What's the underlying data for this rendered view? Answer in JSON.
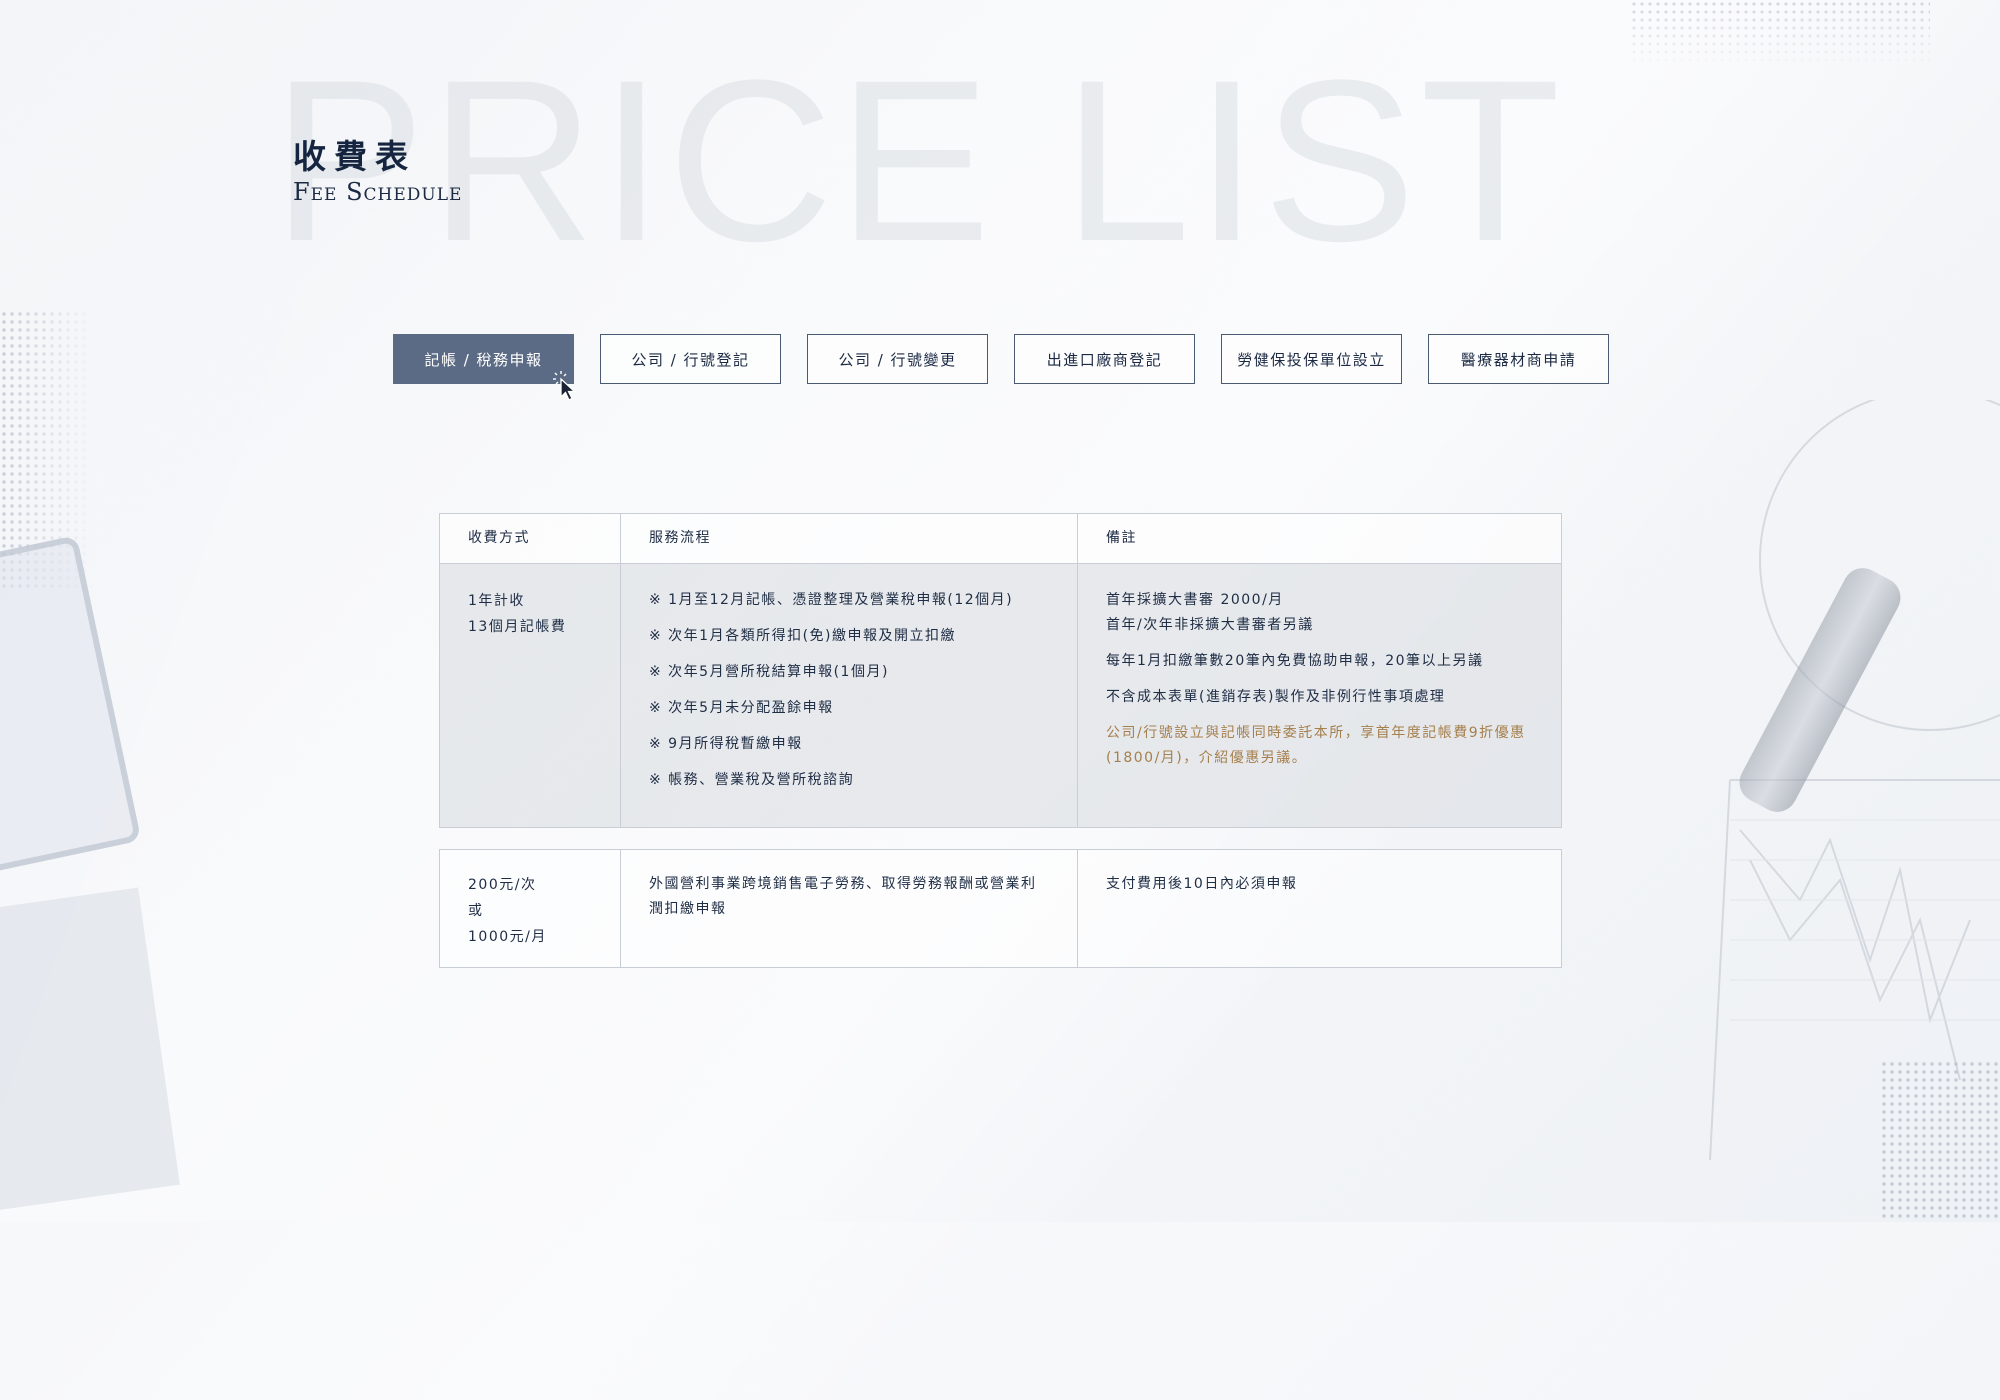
{
  "page": {
    "watermark": "PRICE LIST",
    "title": "收費表",
    "subtitle": "Fee Schedule"
  },
  "tabs": [
    {
      "label": "記帳 / 稅務申報",
      "active": true
    },
    {
      "label": "公司 / 行號登記",
      "active": false
    },
    {
      "label": "公司 / 行號變更",
      "active": false
    },
    {
      "label": "出進口廠商登記",
      "active": false
    },
    {
      "label": "勞健保投保單位設立",
      "active": false
    },
    {
      "label": "醫療器材商申請",
      "active": false
    }
  ],
  "table": {
    "headers": [
      "收費方式",
      "服務流程",
      "備註"
    ],
    "row1": {
      "fee": [
        "1年計收",
        "13個月記帳費"
      ],
      "steps": [
        "※ 1月至12月記帳、憑證整理及營業稅申報(12個月)",
        "※ 次年1月各類所得扣(免)繳申報及開立扣繳",
        "※ 次年5月營所稅結算申報(1個月)",
        "※ 次年5月未分配盈餘申報",
        "※ 9月所得稅暫繳申報",
        "※ 帳務、營業稅及營所稅諮詢"
      ],
      "notes": [
        "首年採擴大書審 2000/月",
        "首年/次年非採擴大書審者另議",
        "每年1月扣繳筆數20筆內免費協助申報，20筆以上另議",
        "不含成本表單(進銷存表)製作及非例行性事項處理"
      ],
      "promo": "公司/行號設立與記帳同時委託本所，享首年度記帳費9折優惠(1800/月)，介紹優惠另議。"
    },
    "row2": {
      "fee": [
        "200元/次",
        "或",
        "1000元/月"
      ],
      "service": "外國營利事業跨境銷售電子勞務、取得勞務報酬或營業利潤扣繳申報",
      "note": "支付費用後10日內必須申報"
    }
  },
  "colors": {
    "accent_tab": "#5c6b85",
    "promo_text": "#a57f4c",
    "text": "#1f2d45"
  }
}
